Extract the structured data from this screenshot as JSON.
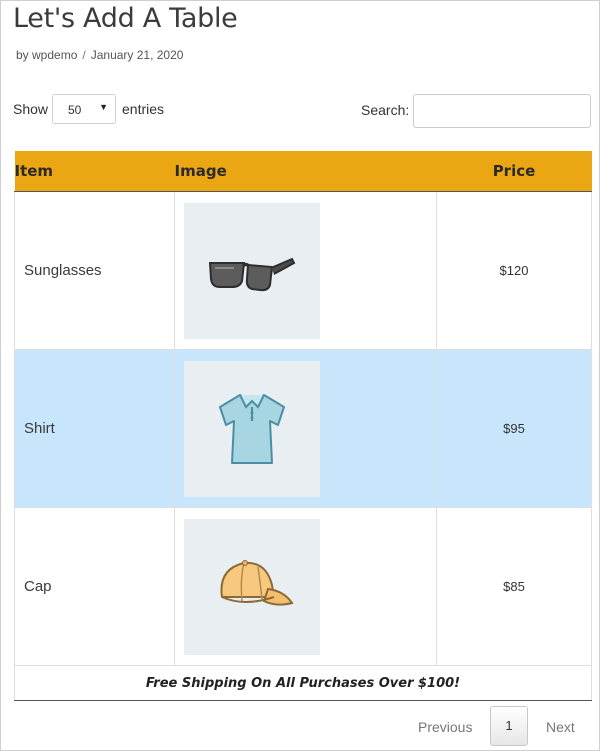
{
  "post": {
    "title": "Let's Add A Table",
    "meta_by": "by wpdemo",
    "meta_separator": "/",
    "meta_date": "January 21, 2020"
  },
  "controls": {
    "show_label": "Show",
    "entries_value": "50",
    "entries_label": "entries",
    "search_label": "Search:",
    "search_value": ""
  },
  "table": {
    "headers": {
      "item": "Item",
      "image": "Image",
      "price": "Price"
    },
    "rows": [
      {
        "item": "Sunglasses",
        "image_icon": "sunglasses-icon",
        "price": "$120"
      },
      {
        "item": "Shirt",
        "image_icon": "shirt-icon",
        "price": "$95"
      },
      {
        "item": "Cap",
        "image_icon": "cap-icon",
        "price": "$85"
      }
    ],
    "footer": "Free Shipping On All Purchases Over $100!"
  },
  "pagination": {
    "previous": "Previous",
    "current": "1",
    "next": "Next"
  },
  "colors": {
    "header_bg": "#eba713",
    "highlight_row": "#c8e6fb",
    "image_bg": "#e9eef3"
  }
}
